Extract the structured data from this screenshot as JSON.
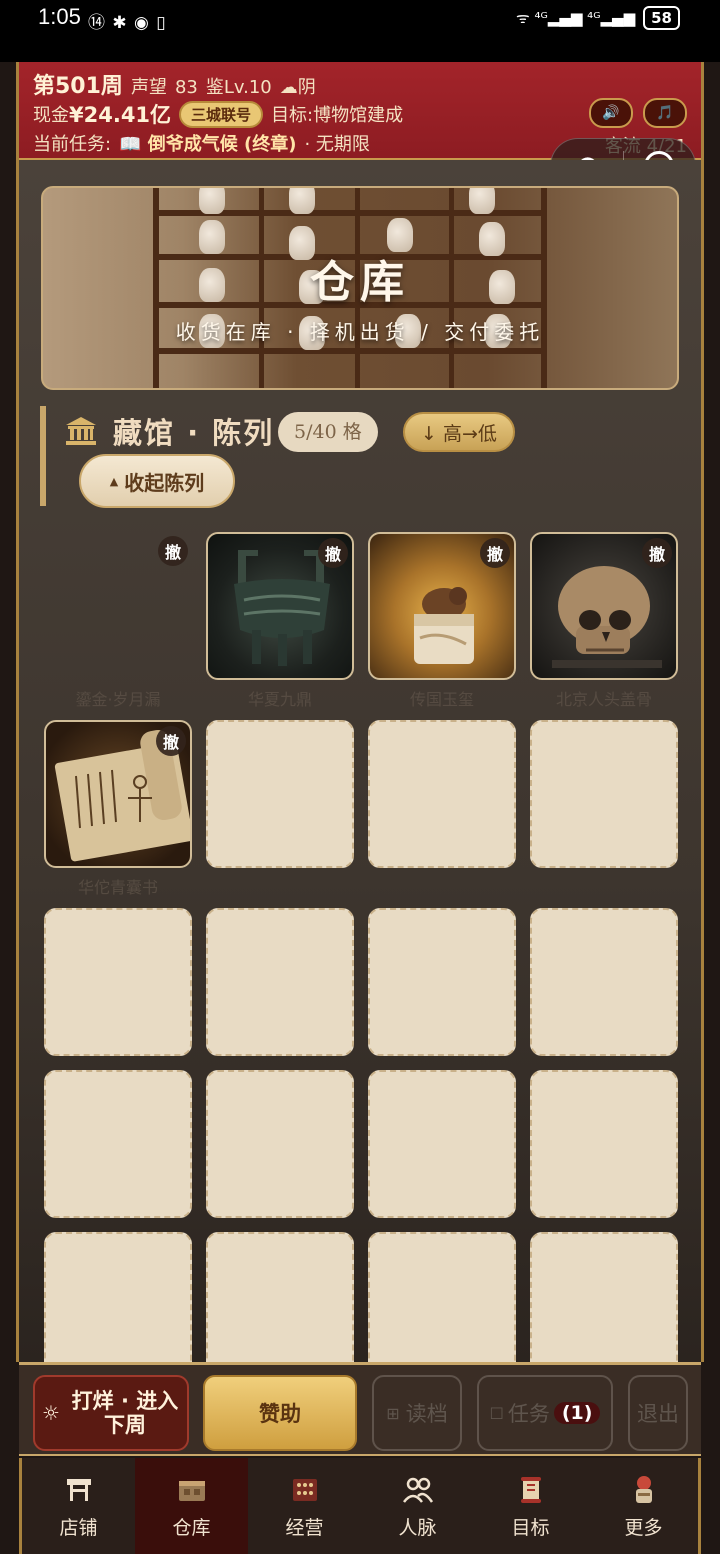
{
  "status_bar": {
    "time": "1:05",
    "left_icons": "⑭ ✱ ◉ ▯",
    "right_icons": "ᯤ ⁴ᴳ▂▄▆ ⁴ᴳ▂▄▆",
    "battery": "58"
  },
  "header": {
    "week": "第501周",
    "reputation_label": "声望",
    "reputation": "83",
    "appraisal": "鉴Lv.10",
    "weather": "☁阴",
    "cash_label": "现金",
    "cash": "¥24.41亿",
    "badge": "三城联号",
    "goal_label": "目标:",
    "goal": "博物馆建成",
    "task_label": "当前任务:",
    "task": "📖 倒爷成气候 (终章)",
    "task_limit": "· 无期限",
    "flow_label": "客流",
    "flow": "4/21",
    "sound_icon": "🔊",
    "music_icon": "🎵"
  },
  "banner": {
    "title": "仓库",
    "subtitle": "收货在库 · 择机出货 / 交付委托"
  },
  "section": {
    "title": "藏馆 · 陈列",
    "count": "5/40 格",
    "sort": "↓ 高→低",
    "fold_label": "收起陈列",
    "fold_icon": "▲"
  },
  "display_items": [
    {
      "name": "鎏金·岁月漏",
      "withdraw": "撤"
    },
    {
      "name": "华夏九鼎",
      "withdraw": "撤"
    },
    {
      "name": "传国玉玺",
      "withdraw": "撤"
    },
    {
      "name": "北京人头盖骨",
      "withdraw": "撤"
    },
    {
      "name": "华佗青囊书",
      "withdraw": "撤"
    }
  ],
  "action_bar": {
    "next_week": "打烊 · 进入下周",
    "sponsor": "赞助",
    "load": "读档",
    "task": "任务",
    "task_count": "(1)",
    "exit": "退出"
  },
  "nav": {
    "items": [
      {
        "label": "店铺",
        "icon": "shop-icon"
      },
      {
        "label": "仓库",
        "icon": "warehouse-icon"
      },
      {
        "label": "经营",
        "icon": "abacus-icon"
      },
      {
        "label": "人脉",
        "icon": "people-icon"
      },
      {
        "label": "目标",
        "icon": "scroll-icon"
      },
      {
        "label": "更多",
        "icon": "more-icon"
      }
    ],
    "active": "仓库"
  },
  "colors": {
    "header_red": "#a3242a",
    "gold": "#c9a76a",
    "slot_cream": "#e8dbc4",
    "nav_active": "#3a0e0b"
  }
}
